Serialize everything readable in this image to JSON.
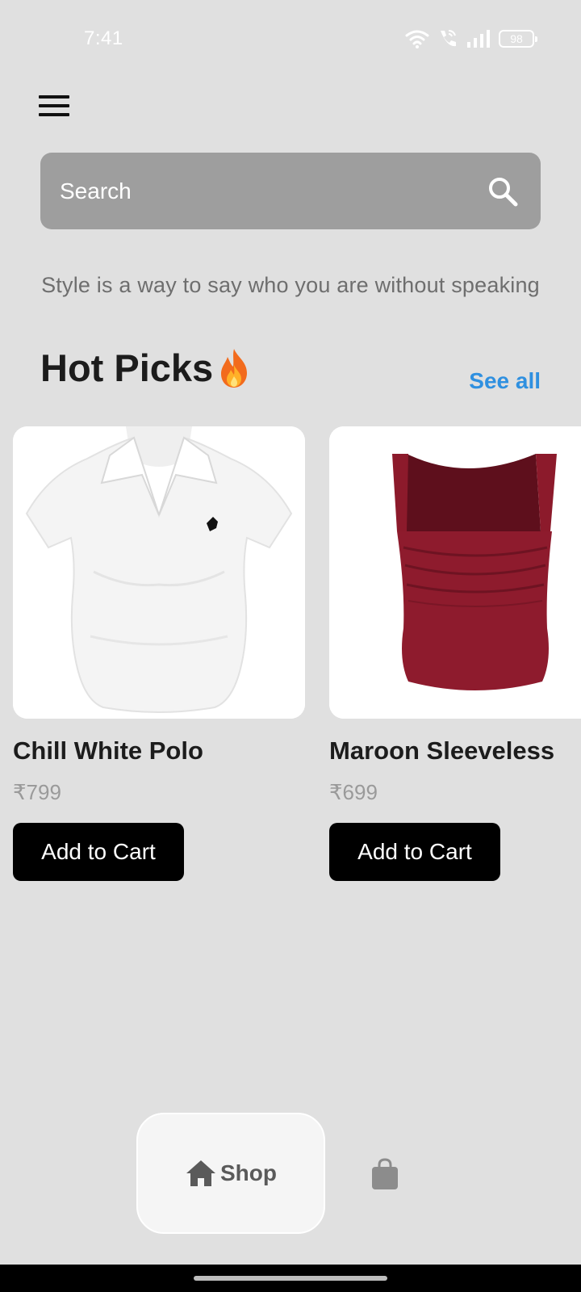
{
  "status_bar": {
    "time": "7:41",
    "battery_level": "98",
    "icons": [
      "wifi-icon",
      "wifi-call-icon",
      "signal-icon",
      "battery-icon"
    ]
  },
  "header": {
    "menu_icon": "hamburger-menu-icon"
  },
  "search": {
    "placeholder": "Search",
    "value": "",
    "icon": "search-icon"
  },
  "tagline": "Style is a way to say who you are without speaking",
  "hot_picks": {
    "title": "Hot Picks",
    "title_icon": "fire-emoji",
    "see_all_label": "See all",
    "accent_color": "#2f90e0"
  },
  "products": [
    {
      "name": "Chill White Polo",
      "price": "₹799",
      "button_label": "Add to Cart",
      "image": "white-polo-shirt-image"
    },
    {
      "name": "Maroon Sleeveless",
      "price": "₹699",
      "button_label": "Add to Cart",
      "image": "maroon-sleeveless-top-image"
    }
  ],
  "bottom_nav": {
    "items": [
      {
        "label": "Shop",
        "icon": "home-icon",
        "active": true
      },
      {
        "label": "",
        "icon": "shopping-bag-icon",
        "active": false
      }
    ]
  }
}
